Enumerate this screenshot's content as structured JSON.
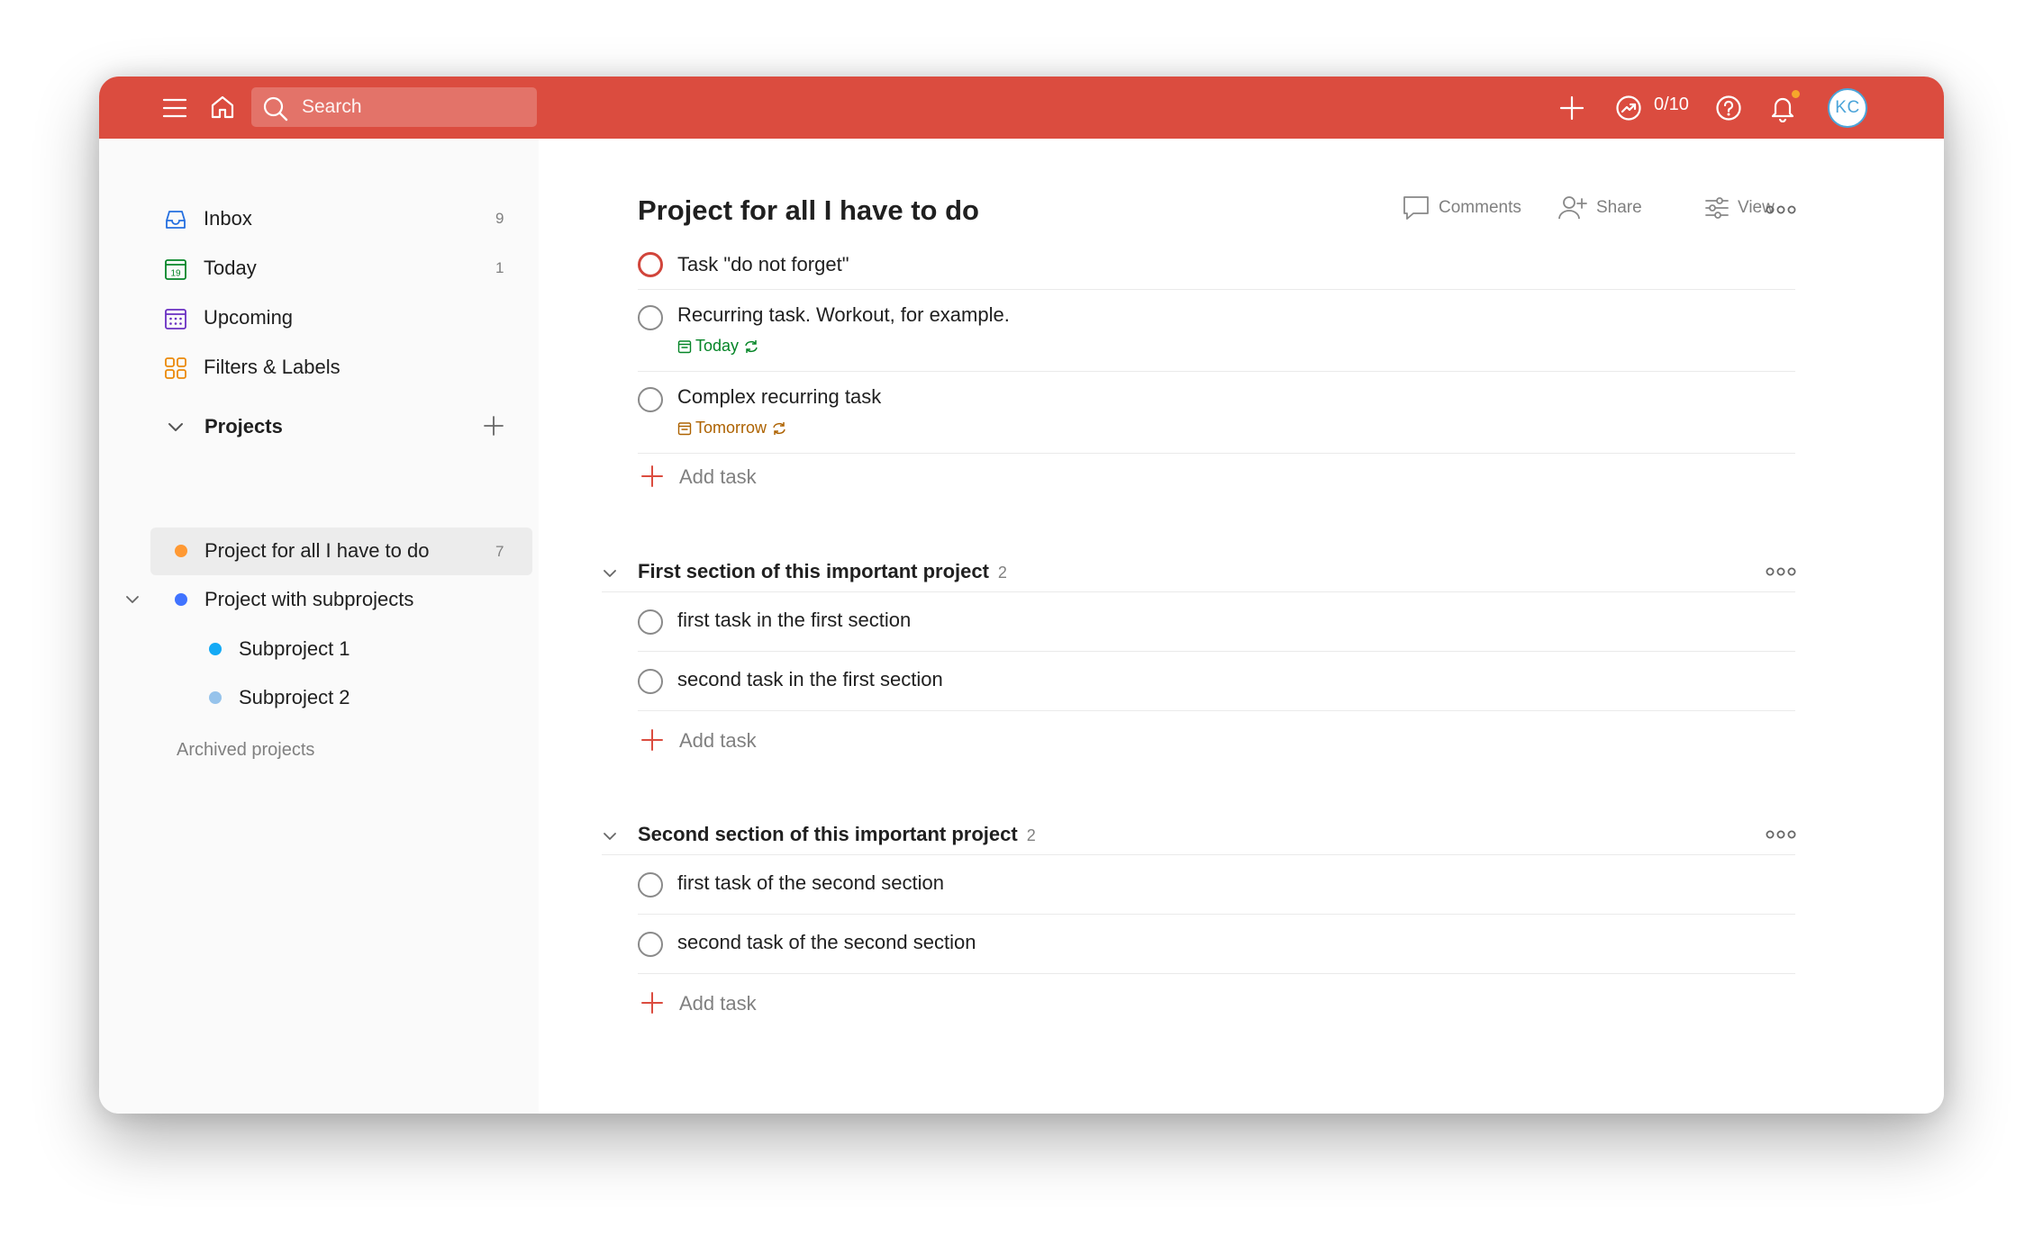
{
  "topbar": {
    "search_placeholder": "Search",
    "karma": "0/10",
    "avatar_initials": "KC",
    "colors": {
      "bar": "#db4c3f",
      "notification_dot": "#f6a72b",
      "avatar": "#4ba4d9"
    },
    "icons": [
      "menu-icon",
      "home-icon",
      "search-icon",
      "plus-icon",
      "productivity-icon",
      "help-icon",
      "bell-icon"
    ]
  },
  "sidebar": {
    "nav": [
      {
        "label": "Inbox",
        "count": "9",
        "icon": "inbox-icon",
        "color": "#246fe0"
      },
      {
        "label": "Today",
        "count": "1",
        "icon": "calendar-today-icon",
        "color": "#058527"
      },
      {
        "label": "Upcoming",
        "count": "",
        "icon": "calendar-upcoming-icon",
        "color": "#692fc2"
      },
      {
        "label": "Filters & Labels",
        "count": "",
        "icon": "filters-icon",
        "color": "#eb8909"
      }
    ],
    "projects_header": "Projects",
    "projects": [
      {
        "label": "Project for all I have to do",
        "count": "7",
        "color": "#ff9933",
        "active": true
      },
      {
        "label": "Project with subprojects",
        "count": "",
        "color": "#4073ff"
      },
      {
        "label": "Subproject 1",
        "count": "",
        "color": "#14aaf5"
      },
      {
        "label": "Subproject 2",
        "count": "",
        "color": "#96c3eb"
      }
    ],
    "archived": "Archived projects"
  },
  "main": {
    "title": "Project for all I have to do",
    "actions": {
      "comments": "Comments",
      "share": "Share",
      "view": "View"
    },
    "add_task_label": "Add task",
    "tasks": [
      {
        "name": "Task \"do not forget\"",
        "priority": "p1"
      },
      {
        "name": "Recurring task. Workout, for example.",
        "due": "Today",
        "due_color": "#058527"
      },
      {
        "name": "Complex recurring task",
        "due": "Tomorrow",
        "due_color": "#ad6200"
      }
    ],
    "sections": [
      {
        "name": "First section of this important project",
        "count": "2",
        "tasks": [
          {
            "name": "first task in the first section"
          },
          {
            "name": "second task in the first section"
          }
        ]
      },
      {
        "name": "Second section of this important project",
        "count": "2",
        "tasks": [
          {
            "name": "first task of the second section"
          },
          {
            "name": "second task of the second section"
          }
        ]
      }
    ]
  }
}
